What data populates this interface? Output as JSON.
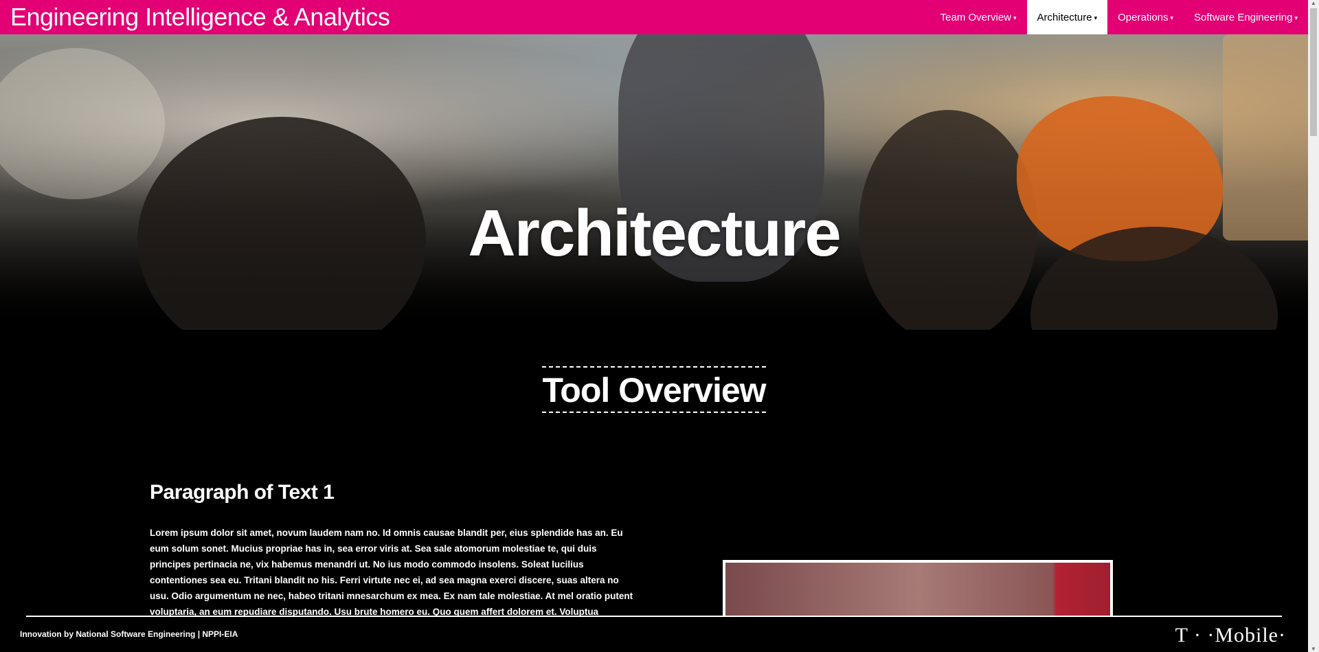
{
  "navbar": {
    "brand": "Engineering Intelligence & Analytics",
    "items": [
      {
        "label": "Team Overview",
        "active": false
      },
      {
        "label": "Architecture",
        "active": true
      },
      {
        "label": "Operations",
        "active": false
      },
      {
        "label": "Software Engineering",
        "active": false
      }
    ],
    "color": "#e20074"
  },
  "hero": {
    "title": "Architecture"
  },
  "section": {
    "title": "Tool Overview",
    "paragraph_heading": "Paragraph of Text 1",
    "paragraph_text": "Lorem ipsum dolor sit amet, novum laudem nam no. Id omnis causae blandit per, eius splendide has an. Eu eum solum sonet. Mucius propriae has in, sea error viris at. Sea sale atomorum molestiae te, qui duis principes pertinacia ne, vix habemus menandri ut. No ius modo commodo insolens. Soleat lucilius contentiones sea eu. Tritani blandit no his. Ferri virtute nec ei, ad sea magna exerci discere, suas altera no usu. Odio argumentum ne nec, habeo tritani mnesarchum ex mea. Ex nam tale molestiae. At mel oratio putent voluptaria, an eum repudiare disputando. Usu brute homero eu. Quo quem affert dolorem et. Voluptua temporibus pro in. Laudem"
  },
  "footer": {
    "text": "Innovation by National Software Engineering  |  NPPI-EIA",
    "logo": "T · ·Mobile·"
  }
}
